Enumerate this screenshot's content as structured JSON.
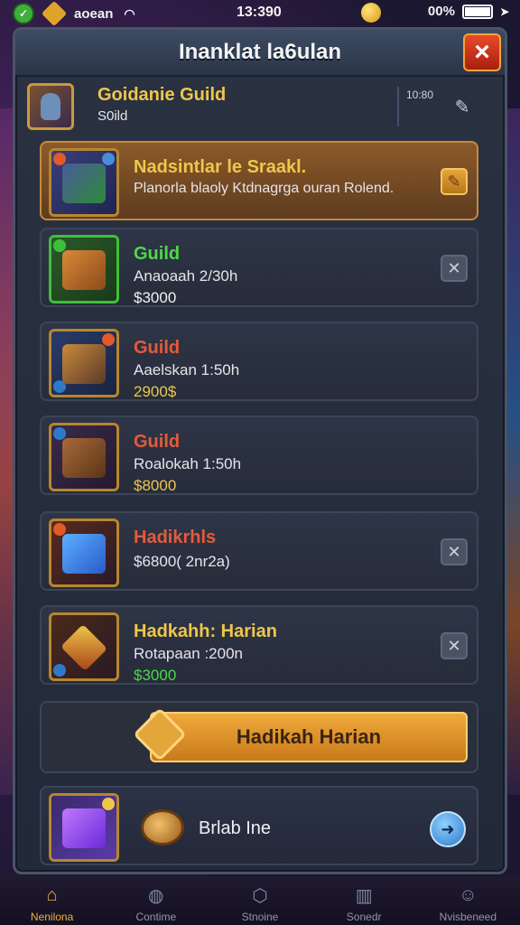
{
  "status_bar": {
    "app_label": "aoean",
    "time": "13:390",
    "battery_text": "00%"
  },
  "panel": {
    "title": "Inanklat la6ulan",
    "close_icon": "close-icon"
  },
  "guild": {
    "name": "Goidanie Guild",
    "sub": "S0ild",
    "time": "10:80"
  },
  "cards": [
    {
      "title": "Nadsintlar le Sraakl.",
      "sub1": "Planorla blaoly Ktdnagrga ouran Rolend.",
      "sub2": "",
      "title_color": "#f0c64a",
      "sub2_color": "#e8e6ef",
      "variant": "highlight"
    },
    {
      "title": "Guild",
      "sub1": "Anaoaah 2/30h",
      "sub2": "$3000",
      "title_color": "#4fd84a",
      "sub2_color": "#f0f0f0",
      "variant": "green"
    },
    {
      "title": "Guild",
      "sub1": "Aaelskan 1:50h",
      "sub2": "2900$",
      "title_color": "#e65a3a",
      "sub2_color": "#f0c64a",
      "variant": "normal"
    },
    {
      "title": "Guild",
      "sub1": "Roalokah 1:50h",
      "sub2": "$8000",
      "title_color": "#e65a3a",
      "sub2_color": "#f0c64a",
      "variant": "normal"
    },
    {
      "title": "Hadikrhls",
      "sub1": "$6800( 2nr2a)",
      "sub2": "",
      "title_color": "#e65a3a",
      "sub2_color": "#f0f0f0",
      "variant": "normal"
    },
    {
      "title": "Hadkahh: Harian",
      "sub1": "Rotapaan :200n",
      "sub2": "$3000",
      "title_color": "#f0c64a",
      "sub2_color": "#4fd84a",
      "variant": "normal"
    }
  ],
  "big_button": {
    "label": "Hadikah Harian"
  },
  "bottom_row": {
    "label": "Brlab Ine"
  },
  "nav": [
    {
      "label": "Nenilona",
      "icon": "home-icon",
      "active": true
    },
    {
      "label": "Contime",
      "icon": "fire-icon",
      "active": false
    },
    {
      "label": "Stnoine",
      "icon": "shield-icon",
      "active": false
    },
    {
      "label": "Sonedr",
      "icon": "chart-icon",
      "active": false
    },
    {
      "label": "Nvisbeneed",
      "icon": "profile-icon",
      "active": false
    }
  ],
  "colors": {
    "accent_gold": "#f0c64a",
    "accent_green": "#4fd84a",
    "accent_red": "#e65a3a",
    "panel_bg": "#2a3242"
  }
}
